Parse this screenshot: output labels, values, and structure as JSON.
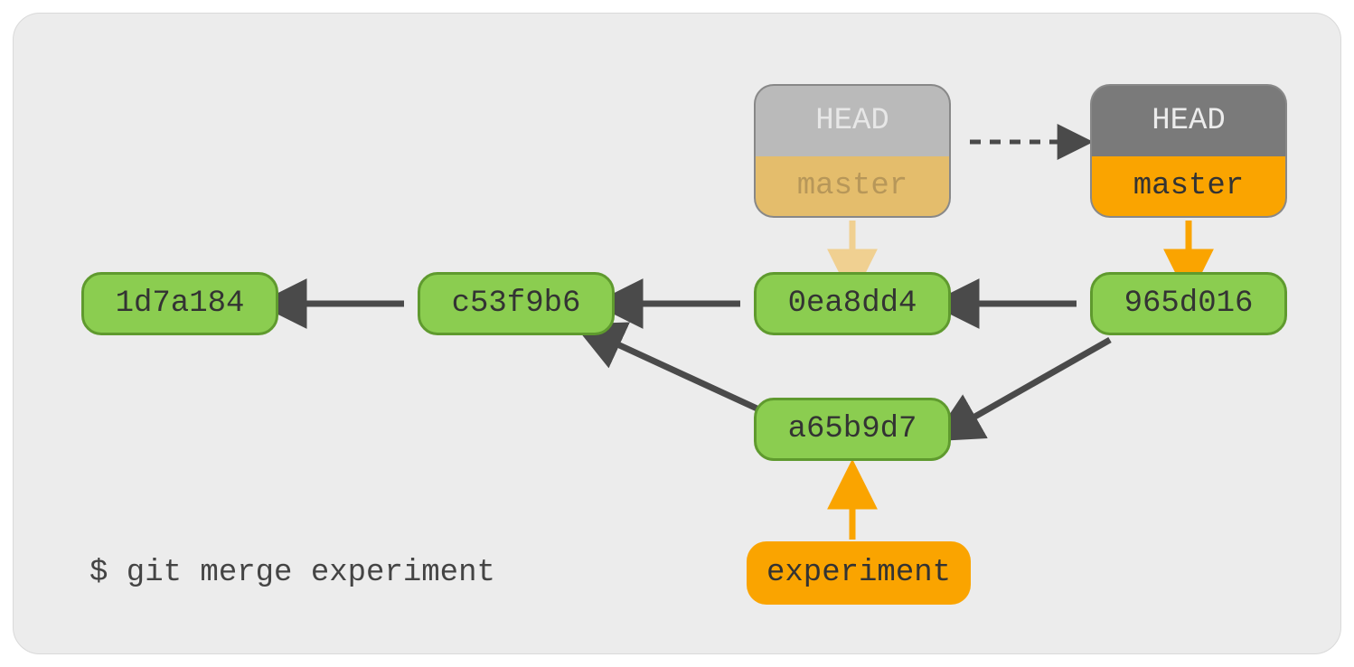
{
  "command": "$ git merge experiment",
  "commits": {
    "c1": "1d7a184",
    "c2": "c53f9b6",
    "c3": "0ea8dd4",
    "c4": "965d016",
    "c5": "a65b9d7"
  },
  "labels": {
    "head_old": "HEAD",
    "master_old": "master",
    "head_new": "HEAD",
    "master_new": "master",
    "experiment": "experiment"
  },
  "colors": {
    "commit_fill": "#8bcd50",
    "commit_stroke": "#5f9a2e",
    "branch_fill": "#faa400",
    "head_fill": "#7a7a7a",
    "head_faded": "#bababa",
    "branch_faded": "#e4bd6c",
    "arrow_dark": "#4a4a4a",
    "arrow_orange": "#faa400",
    "arrow_orange_faded": "#f0d091",
    "bg": "#ececec"
  }
}
